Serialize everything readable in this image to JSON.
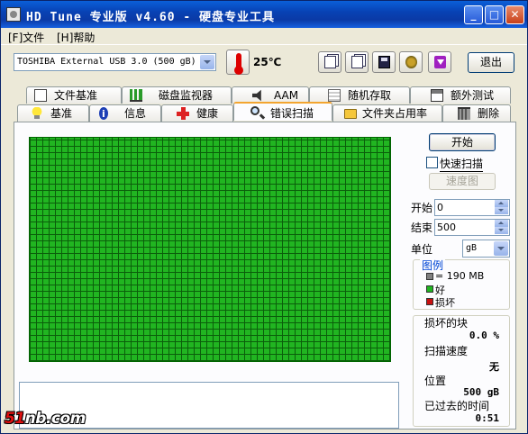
{
  "window": {
    "title": "HD Tune 专业版 v4.60 - 硬盘专业工具"
  },
  "menu": {
    "file": "[F]文件",
    "help": "[H]帮助"
  },
  "toolbar": {
    "drive": "TOSHIBA External USB 3.0 (500 gB)",
    "temperature": "25℃",
    "exit_label": "退出"
  },
  "tabs_top": [
    {
      "label": "文件基准",
      "icon": "document-icon"
    },
    {
      "label": "磁盘监视器",
      "icon": "chart-icon"
    },
    {
      "label": "AAM",
      "icon": "speaker-icon"
    },
    {
      "label": "随机存取",
      "icon": "random-icon"
    },
    {
      "label": "额外测试",
      "icon": "extra-test-icon"
    }
  ],
  "tabs_bottom": [
    {
      "label": "基准",
      "icon": "bulb-icon"
    },
    {
      "label": "信息",
      "icon": "info-icon"
    },
    {
      "label": "健康",
      "icon": "health-cross-icon"
    },
    {
      "label": "错误扫描",
      "icon": "magnifier-icon"
    },
    {
      "label": "文件夹占用率",
      "icon": "folder-icon"
    },
    {
      "label": "删除",
      "icon": "trash-icon"
    }
  ],
  "active_tab": "错误扫描",
  "scan": {
    "start_button": "开始",
    "quick_scan_label": "快速扫描",
    "quick_scan_checked": false,
    "speed_map_button": "速度图",
    "start_label": "开始",
    "start_value": "0",
    "end_label": "结束",
    "end_value": "500",
    "unit_label": "单位",
    "unit_value": "gB"
  },
  "legend": {
    "title": "图例",
    "items": [
      {
        "label": "= 190 MB",
        "color": "#808080"
      },
      {
        "label": "好",
        "color": "#21b521"
      },
      {
        "label": "损坏",
        "color": "#c81010"
      }
    ]
  },
  "stats": {
    "damaged_label": "损坏的块",
    "damaged_value": "0.0 %",
    "speed_label": "扫描速度",
    "speed_value": "无",
    "position_label": "位置",
    "position_value": "500 gB",
    "elapsed_label": "已过去的时间",
    "elapsed_value": "0:51"
  },
  "watermark": {
    "num": "51",
    "rest": "nb.com"
  },
  "colors": {
    "block_good": "#21b521",
    "titlebar": "#0a3aa6"
  }
}
